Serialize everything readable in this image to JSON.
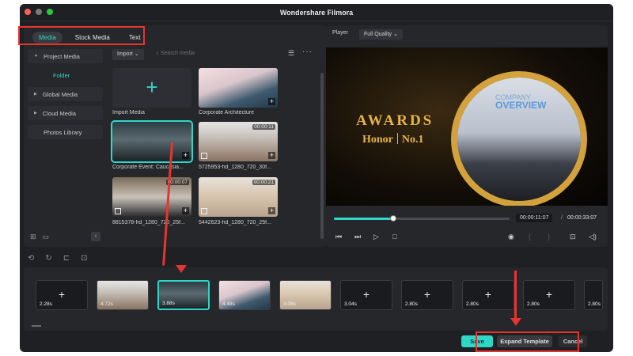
{
  "window": {
    "title": "Wondershare Filmora"
  },
  "media_panel": {
    "tabs": [
      {
        "label": "Media",
        "active": true
      },
      {
        "label": "Stock Media",
        "active": false
      },
      {
        "label": "Text",
        "active": false
      }
    ],
    "nav": {
      "project_media": "Project Media",
      "folder": "Folder",
      "global_media": "Global Media",
      "cloud_media": "Cloud Media",
      "photos_library": "Photos Library"
    },
    "toolbar": {
      "import_label": "Import",
      "search_placeholder": "Search media"
    },
    "items": [
      {
        "label": "Import Media",
        "duration": ""
      },
      {
        "label": "Corporate Architecture",
        "duration": ""
      },
      {
        "label": "Corporate Event: Caucasia...",
        "duration": ""
      },
      {
        "label": "5725953-hd_1280_720_30f...",
        "duration": "00:00:11"
      },
      {
        "label": "8815378-hd_1280_720_25f...",
        "duration": "00:00:07"
      },
      {
        "label": "5442623-hd_1280_720_25f...",
        "duration": "00:00:21"
      }
    ]
  },
  "player": {
    "label": "Player",
    "quality": "Full Quality",
    "current_time": "00:00:11:07",
    "separator": "/",
    "total_time": "00:00:33:07",
    "progress": 0.34,
    "video_text": {
      "awards": "AWARDS",
      "honor": "Honor",
      "no1": "No.1",
      "company": "COMPANY",
      "overview": "OVERVIEW"
    }
  },
  "timeline": {
    "clips": [
      {
        "duration": "2.28s",
        "has_thumb": false
      },
      {
        "duration": "4.72s",
        "has_thumb": true
      },
      {
        "duration": "3.88s",
        "has_thumb": true,
        "active": true
      },
      {
        "duration": "4.48s",
        "has_thumb": true
      },
      {
        "duration": "3.08s",
        "has_thumb": true
      },
      {
        "duration": "3.04s",
        "has_thumb": false
      },
      {
        "duration": "2.80s",
        "has_thumb": false
      },
      {
        "duration": "2.80s",
        "has_thumb": false
      },
      {
        "duration": "2.80s",
        "has_thumb": false
      },
      {
        "duration": "2.80s",
        "has_thumb": false
      }
    ]
  },
  "buttons": {
    "save": "Save",
    "expand_template": "Expand Template",
    "cancel": "Cancel"
  },
  "colors": {
    "accent": "#2fd7c8",
    "annotation": "#e8342f",
    "gold": "#e7b34a",
    "window_bg": "#1f2024"
  }
}
